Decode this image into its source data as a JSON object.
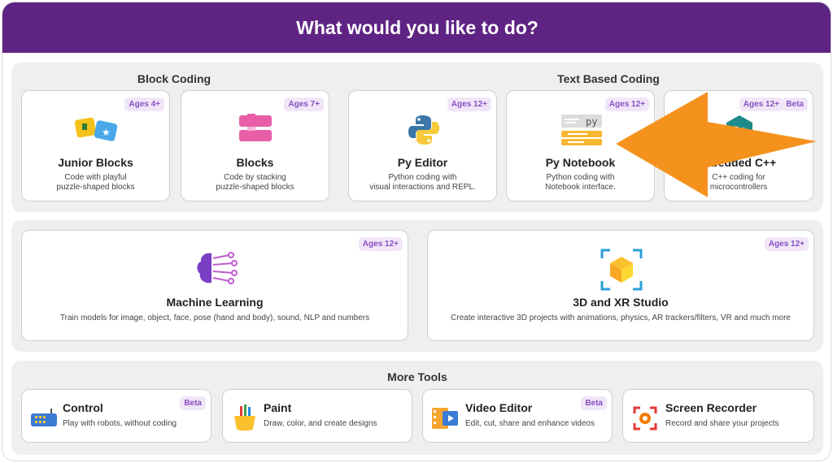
{
  "header": {
    "title": "What would you like to do?"
  },
  "sections": {
    "block_coding": "Block Coding",
    "text_coding": "Text Based Coding",
    "more_tools": "More Tools"
  },
  "cards": [
    {
      "title": "Junior Blocks",
      "age": "Ages 4+",
      "desc1": "Code with playful",
      "desc2": "puzzle-shaped blocks",
      "icon": "junior-blocks-icon"
    },
    {
      "title": "Blocks",
      "age": "Ages 7+",
      "desc1": "Code by stacking",
      "desc2": "puzzle-shaped blocks",
      "icon": "blocks-icon"
    },
    {
      "title": "Py Editor",
      "age": "Ages 12+",
      "desc1": "Python coding with",
      "desc2": "visual interactions and REPL.",
      "icon": "python-icon"
    },
    {
      "title": "Py Notebook",
      "age": "Ages 12+",
      "desc1": "Python coding with",
      "desc2": "Notebook interface.",
      "icon": "notebook-icon"
    },
    {
      "title": "mbedded C++",
      "age": "Ages 12+",
      "badge2": "Beta",
      "desc1": "C++ coding for",
      "desc2": "microcontrollers",
      "icon": "cpp-icon"
    }
  ],
  "wide_cards": [
    {
      "title": "Machine Learning",
      "age": "Ages 12+",
      "desc": "Train models for image, object, face, pose (hand and body), sound, NLP and numbers",
      "icon": "brain-icon"
    },
    {
      "title": "3D and XR Studio",
      "age": "Ages 12+",
      "desc": "Create interactive 3D projects with animations, physics, AR trackers/filters, VR and much more",
      "icon": "cube-icon"
    }
  ],
  "tools": [
    {
      "title": "Control",
      "badge": "Beta",
      "desc": "Play with robots, without coding",
      "icon": "gamepad-icon"
    },
    {
      "title": "Paint",
      "badge": "",
      "desc": "Draw, color, and create designs",
      "icon": "paint-bucket-icon"
    },
    {
      "title": "Video Editor",
      "badge": "Beta",
      "desc": "Edit, cut, share and enhance videos",
      "icon": "video-editor-icon"
    },
    {
      "title": "Screen Recorder",
      "badge": "",
      "desc": "Record and share your projects",
      "icon": "screen-recorder-icon"
    }
  ],
  "colors": {
    "header": "#5f2483",
    "badge_text": "#8a4fc4",
    "arrow": "#f5921e"
  }
}
